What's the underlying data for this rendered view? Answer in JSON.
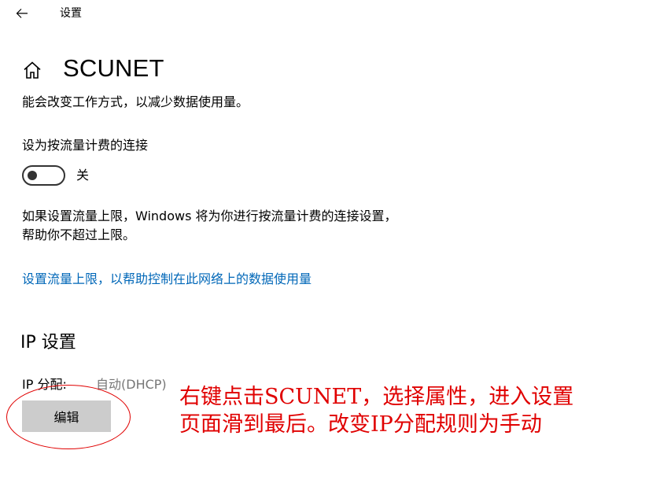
{
  "titlebar": {
    "back_icon": "arrow-left-icon",
    "title": "设置"
  },
  "header": {
    "home_icon": "home-icon",
    "title": "SCUNET"
  },
  "description": "能会改变工作方式，以减少数据使用量。",
  "metered": {
    "label": "设为按流量计费的连接",
    "toggle_state": "关",
    "toggle_on": false
  },
  "limit": {
    "info_line1": "如果设置流量上限，Windows 将为你进行按流量计费的连接设置，",
    "info_line2": "帮助你不超过上限。",
    "link": "设置流量上限，以帮助控制在此网络上的数据使用量"
  },
  "ip": {
    "section_title": "IP 设置",
    "assign_label": "IP 分配:",
    "assign_value": "自动(DHCP)",
    "edit_button": "编辑"
  },
  "annotation": {
    "line1": "右键点击SCUNET，选择属性，进入设置",
    "line2": "页面滑到最后。改变IP分配规则为手动",
    "color": "#e00000"
  },
  "colors": {
    "link": "#0067b8",
    "secondary_text": "#767676",
    "button_bg": "#cccccc"
  }
}
